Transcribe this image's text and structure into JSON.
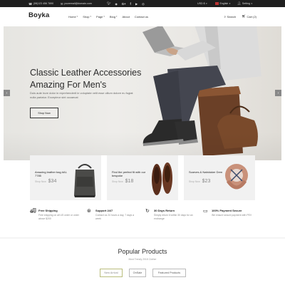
{
  "topbar": {
    "phone": "(08)123 456 7890",
    "email": "youremail@domain.com",
    "social": [
      "twitter",
      "rss",
      "google-plus",
      "facebook",
      "youtube",
      "instagram"
    ],
    "currency": "USD $",
    "language": "English",
    "account": "Setting"
  },
  "header": {
    "logo": "Boyka",
    "nav": [
      {
        "label": "Home",
        "caret": true
      },
      {
        "label": "Shop",
        "caret": true
      },
      {
        "label": "Page",
        "caret": true
      },
      {
        "label": "Blog",
        "caret": true
      },
      {
        "label": "About",
        "caret": false
      },
      {
        "label": "Contact us",
        "caret": false
      }
    ],
    "search_label": "Search",
    "cart_label": "Cart (2)"
  },
  "hero": {
    "title_line1": "Classic Leather Accessories",
    "title_line2": "Amazing For Men's",
    "text": "Duis aute irure dolor in reprehenderit in voluptate velit esse cillum dolore eu fugiat nulla pariatur. Excepteur sint occaecat",
    "button": "Shop Now",
    "prev_icon": "‹",
    "next_icon": "›"
  },
  "cards": [
    {
      "title": "Amazing leather bag #AI-7785",
      "shop": "Shop Now",
      "price": "$34"
    },
    {
      "title": "Find the perfect fit with our bespoke",
      "shop": "Shop Now",
      "price": "$18"
    },
    {
      "title": "Scarves & Nabiduker Dem",
      "shop": "Shop Now",
      "price": "$23"
    }
  ],
  "services": [
    {
      "title": "Free Shipping",
      "desc": "Free shipping on all US order or order above $200"
    },
    {
      "title": "Support 24/7",
      "desc": "Contact us 24 hours a day, 7 days a week"
    },
    {
      "title": "30 Days Return",
      "desc": "Simply return it within 30 days for an exchange"
    },
    {
      "title": "100% Payment Secure",
      "desc": "We ensure secure payment with PEV"
    }
  ],
  "popular": {
    "title": "Popular Products",
    "subtitle": "Most Trendy 2018 Clother",
    "tabs": [
      "New Arrival",
      "OnSale",
      "Featured Products"
    ]
  },
  "colors": {
    "topbar_bg": "#1f1f1f",
    "hero_bg": "#e9e7e3",
    "card_bg": "#f1f1f1",
    "tab_active_border": "#b9bd7d"
  }
}
